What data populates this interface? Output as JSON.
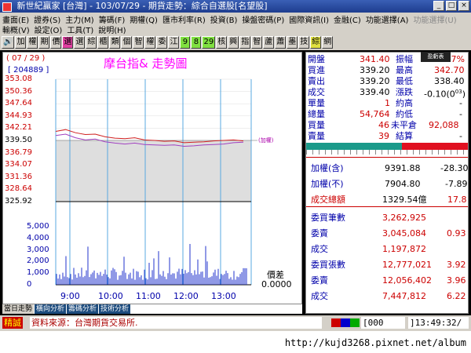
{
  "window": {
    "title": "新世紀贏家 [台灣] - 103/07/29 - 期貨走勢：綜合自選股[名望股]"
  },
  "menu": {
    "row1": [
      "畫面(E)",
      "證券(S)",
      "主力(M)",
      "籌碼(F)",
      "期權(Q)",
      "匯市利率(R)",
      "投資(B)",
      "操盤密碼(P)",
      "國際資訊(I)",
      "金融(C)",
      "功能選擇(A)",
      "功能選擇(U)"
    ],
    "row2": [
      "輸概(V)",
      "設定(O)",
      "工具(T)",
      "說明(H)"
    ]
  },
  "toolbar": [
    "🔊",
    "加",
    "權",
    "期",
    "價",
    "選",
    "選",
    "綜",
    "櫃",
    "類",
    "個",
    "智",
    "權",
    "委",
    "江",
    "9",
    "8",
    "29",
    "核",
    "興",
    "指",
    "智",
    "蘆",
    "蕭",
    "墨",
    "技",
    "綜",
    "網"
  ],
  "chart": {
    "date": "( 07 / 29 )",
    "volume_label": "[ 204889 ]",
    "title": "摩台指& 走勢圖",
    "y_ticks": [
      "353.08",
      "350.36",
      "347.64",
      "344.93",
      "342.21",
      "339.50",
      "336.79",
      "334.07",
      "331.36",
      "328.64",
      "325.92"
    ],
    "vol_ticks": [
      "5,000",
      "4,000",
      "3,000",
      "2,000",
      "1,000",
      "0"
    ],
    "x_ticks": [
      "9:00",
      "10:00",
      "11:00",
      "12:00",
      "13:00"
    ],
    "jiaquan_label": "(加權)",
    "spread_label": "價差",
    "spread_value": "0.0000"
  },
  "chart_data": {
    "type": "line",
    "title": "摩台指& 走勢圖",
    "ylim": [
      325.92,
      353.08
    ],
    "x_ticks": [
      "9:00",
      "10:00",
      "11:00",
      "12:00",
      "13:00"
    ],
    "series": [
      {
        "values": [
          341.5,
          341.9,
          341.2,
          340.8,
          340.9,
          340.3,
          340.0,
          339.9,
          340.1,
          339.6,
          339.5,
          339.3,
          339.4,
          339.0,
          339.1,
          339.2,
          339.4,
          339.5,
          339.6,
          339.4
        ]
      },
      {
        "values": [
          340.6,
          340.9,
          340.1,
          339.6,
          339.8,
          339.2,
          338.9,
          338.7,
          338.9,
          338.6,
          338.5,
          338.4,
          338.5,
          338.2,
          338.3,
          338.5,
          338.6,
          338.7,
          339.0,
          339.1
        ]
      }
    ],
    "volume": {
      "ylim": [
        0,
        5000
      ],
      "ticks": [
        0,
        1000,
        2000,
        3000,
        4000,
        5000
      ]
    }
  },
  "quote": {
    "open_label": "開盤",
    "open": "341.40",
    "range_label": "振幅",
    "range": "1.27%",
    "buy_label": "買進",
    "buy": "339.20",
    "high_label": "最高",
    "high": "342.70",
    "sell_label": "賣出",
    "sell": "339.20",
    "low_label": "最低",
    "low": "338.40",
    "deal_label": "成交",
    "deal": "339.40",
    "change_label": "漲跌",
    "change": "-0.10(0",
    "change_sup": "03",
    "change_tail": ")",
    "single_label": "單量",
    "single": "1",
    "yue_high_label": "約高",
    "yue_high": "-",
    "total_label": "總量",
    "total": "54,764",
    "yue_low_label": "約低",
    "yue_low": "-",
    "buyq_label": "買量",
    "buyq": "46",
    "open_int_label": "未平倉",
    "open_int": "92,088",
    "sellq_label": "賣量",
    "sellq": "39",
    "settle_label": "結算",
    "settle": "-",
    "popup": "盈虧表"
  },
  "index": {
    "a_label": "加權(含)",
    "a_val": "9391.88",
    "a_chg": "-28.30",
    "b_label": "加權(不)",
    "b_val": "7904.80",
    "b_chg": "-7.89",
    "c_label": "成交總額",
    "c_val": "1329.54億",
    "c_chg": "17.8"
  },
  "orders": [
    {
      "label": "委買筆數",
      "value": "3,262,925",
      "ratio": ""
    },
    {
      "label": "委賣",
      "value": "3,045,084",
      "ratio": "0.93"
    },
    {
      "label": "成交",
      "value": "1,197,872",
      "ratio": ""
    },
    {
      "label": "委買張數",
      "value": "12,777,021",
      "ratio": "3.92"
    },
    {
      "label": "委賣",
      "value": "12,056,402",
      "ratio": "3.96"
    },
    {
      "label": "成交",
      "value": "7,447,812",
      "ratio": "6.22"
    }
  ],
  "tabs": [
    "當日走勢",
    "橫向分析",
    "籌碼分析",
    "技術分析"
  ],
  "status": {
    "jc": "精誠",
    "source": "資料來源：台灣期貨交易所.",
    "counter": "[000",
    "clock": "]13:49:32/"
  },
  "footer_url": "http://kujd3268.pixnet.net/album",
  "colors": {
    "title_bg": "#1e3d8f",
    "chart_bg": "#ffffff",
    "accent_red": "#cc0000",
    "accent_blue": "#0000aa"
  }
}
